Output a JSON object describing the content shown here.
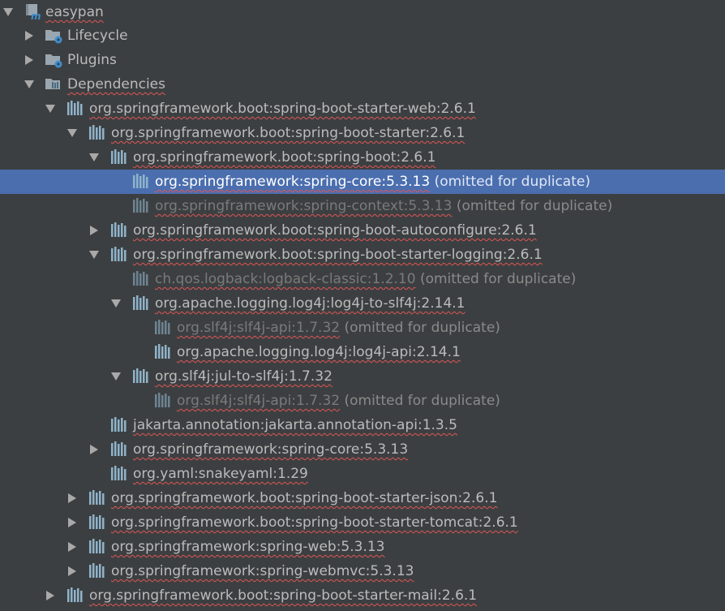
{
  "project": {
    "name": "easypan"
  },
  "sections": {
    "lifecycle": "Lifecycle",
    "plugins": "Plugins",
    "dependencies": "Dependencies"
  },
  "deps": [
    {
      "coord": "org.springframework.boot:spring-boot-starter-web:2.6.1",
      "note": ""
    },
    {
      "coord": "org.springframework.boot:spring-boot-starter:2.6.1",
      "note": ""
    },
    {
      "coord": "org.springframework.boot:spring-boot:2.6.1",
      "note": ""
    },
    {
      "coord": "org.springframework:spring-core:5.3.13",
      "note": "(omitted for duplicate)"
    },
    {
      "coord": "org.springframework:spring-context:5.3.13",
      "note": "(omitted for duplicate)"
    },
    {
      "coord": "org.springframework.boot:spring-boot-autoconfigure:2.6.1",
      "note": ""
    },
    {
      "coord": "org.springframework.boot:spring-boot-starter-logging:2.6.1",
      "note": ""
    },
    {
      "coord": "ch.qos.logback:logback-classic:1.2.10",
      "note": "(omitted for duplicate)"
    },
    {
      "coord": "org.apache.logging.log4j:log4j-to-slf4j:2.14.1",
      "note": ""
    },
    {
      "coord": "org.slf4j:slf4j-api:1.7.32",
      "note": "(omitted for duplicate)"
    },
    {
      "coord": "org.apache.logging.log4j:log4j-api:2.14.1",
      "note": ""
    },
    {
      "coord": "org.slf4j:jul-to-slf4j:1.7.32",
      "note": ""
    },
    {
      "coord": "org.slf4j:slf4j-api:1.7.32",
      "note": "(omitted for duplicate)"
    },
    {
      "coord": "jakarta.annotation:jakarta.annotation-api:1.3.5",
      "note": ""
    },
    {
      "coord": "org.springframework:spring-core:5.3.13",
      "note": ""
    },
    {
      "coord": "org.yaml:snakeyaml:1.29",
      "note": ""
    },
    {
      "coord": "org.springframework.boot:spring-boot-starter-json:2.6.1",
      "note": ""
    },
    {
      "coord": "org.springframework.boot:spring-boot-starter-tomcat:2.6.1",
      "note": ""
    },
    {
      "coord": "org.springframework:spring-web:5.3.13",
      "note": ""
    },
    {
      "coord": "org.springframework:spring-webmvc:5.3.13",
      "note": ""
    },
    {
      "coord": "org.springframework.boot:spring-boot-starter-mail:2.6.1",
      "note": ""
    }
  ],
  "colors": {
    "background": "#3c3f41",
    "selection": "#4b6eaf",
    "text": "#bbbbbb",
    "muted_text": "#7a7a7a",
    "library_icon": "#8fb3c9",
    "folder_icon": "#9aa7b0",
    "gear_icon": "#3d8fd1",
    "squiggle": "#e05555"
  },
  "icons": {
    "project": "maven-module-icon",
    "lifecycle": "folder-gear-icon",
    "plugins": "folder-gear-icon",
    "dependencies": "library-folder-icon",
    "dependency": "library-icon"
  }
}
